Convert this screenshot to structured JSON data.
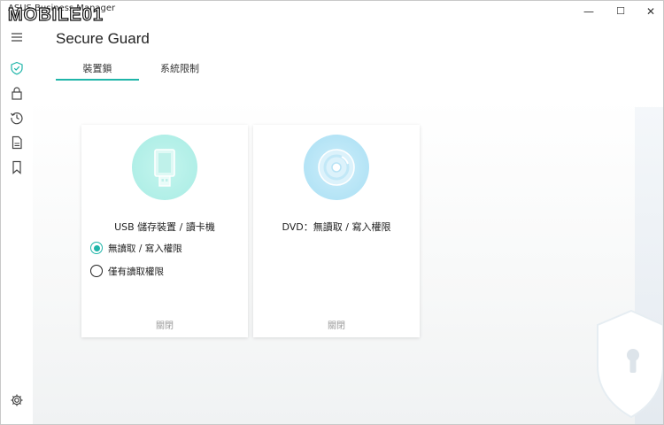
{
  "window": {
    "app_title": "ASUS Business Manager",
    "watermark_text": "MOBILE01",
    "minimize": "—",
    "maximize": "☐",
    "close": "✕"
  },
  "sidebar": {
    "items": [
      {
        "name": "menu",
        "icon": "hamburger-icon"
      },
      {
        "name": "secure-guard",
        "icon": "shield-check-icon",
        "active": true
      },
      {
        "name": "lock",
        "icon": "lock-icon"
      },
      {
        "name": "history",
        "icon": "history-icon"
      },
      {
        "name": "document",
        "icon": "document-icon"
      },
      {
        "name": "bookmark",
        "icon": "bookmark-icon"
      },
      {
        "name": "settings",
        "icon": "gear-icon"
      }
    ]
  },
  "header": {
    "title": "Secure Guard",
    "tabs": [
      {
        "label": "裝置鎖",
        "active": true
      },
      {
        "label": "系統限制",
        "active": false
      }
    ]
  },
  "cards": [
    {
      "icon": "usb-drive-icon",
      "title": "USB 儲存裝置 / 讀卡機",
      "options": [
        {
          "label": "無讀取 / 寫入權限",
          "selected": true
        },
        {
          "label": "僅有讀取權限",
          "selected": false
        }
      ],
      "action": "關閉"
    },
    {
      "icon": "disc-icon",
      "title": "DVD：無讀取 / 寫入權限",
      "action": "關閉"
    }
  ],
  "colors": {
    "accent": "#1fb5a9",
    "usb_circle": "#a8ece4",
    "dvd_circle": "#a9dff4",
    "disabled_text": "#9a9a9a"
  }
}
